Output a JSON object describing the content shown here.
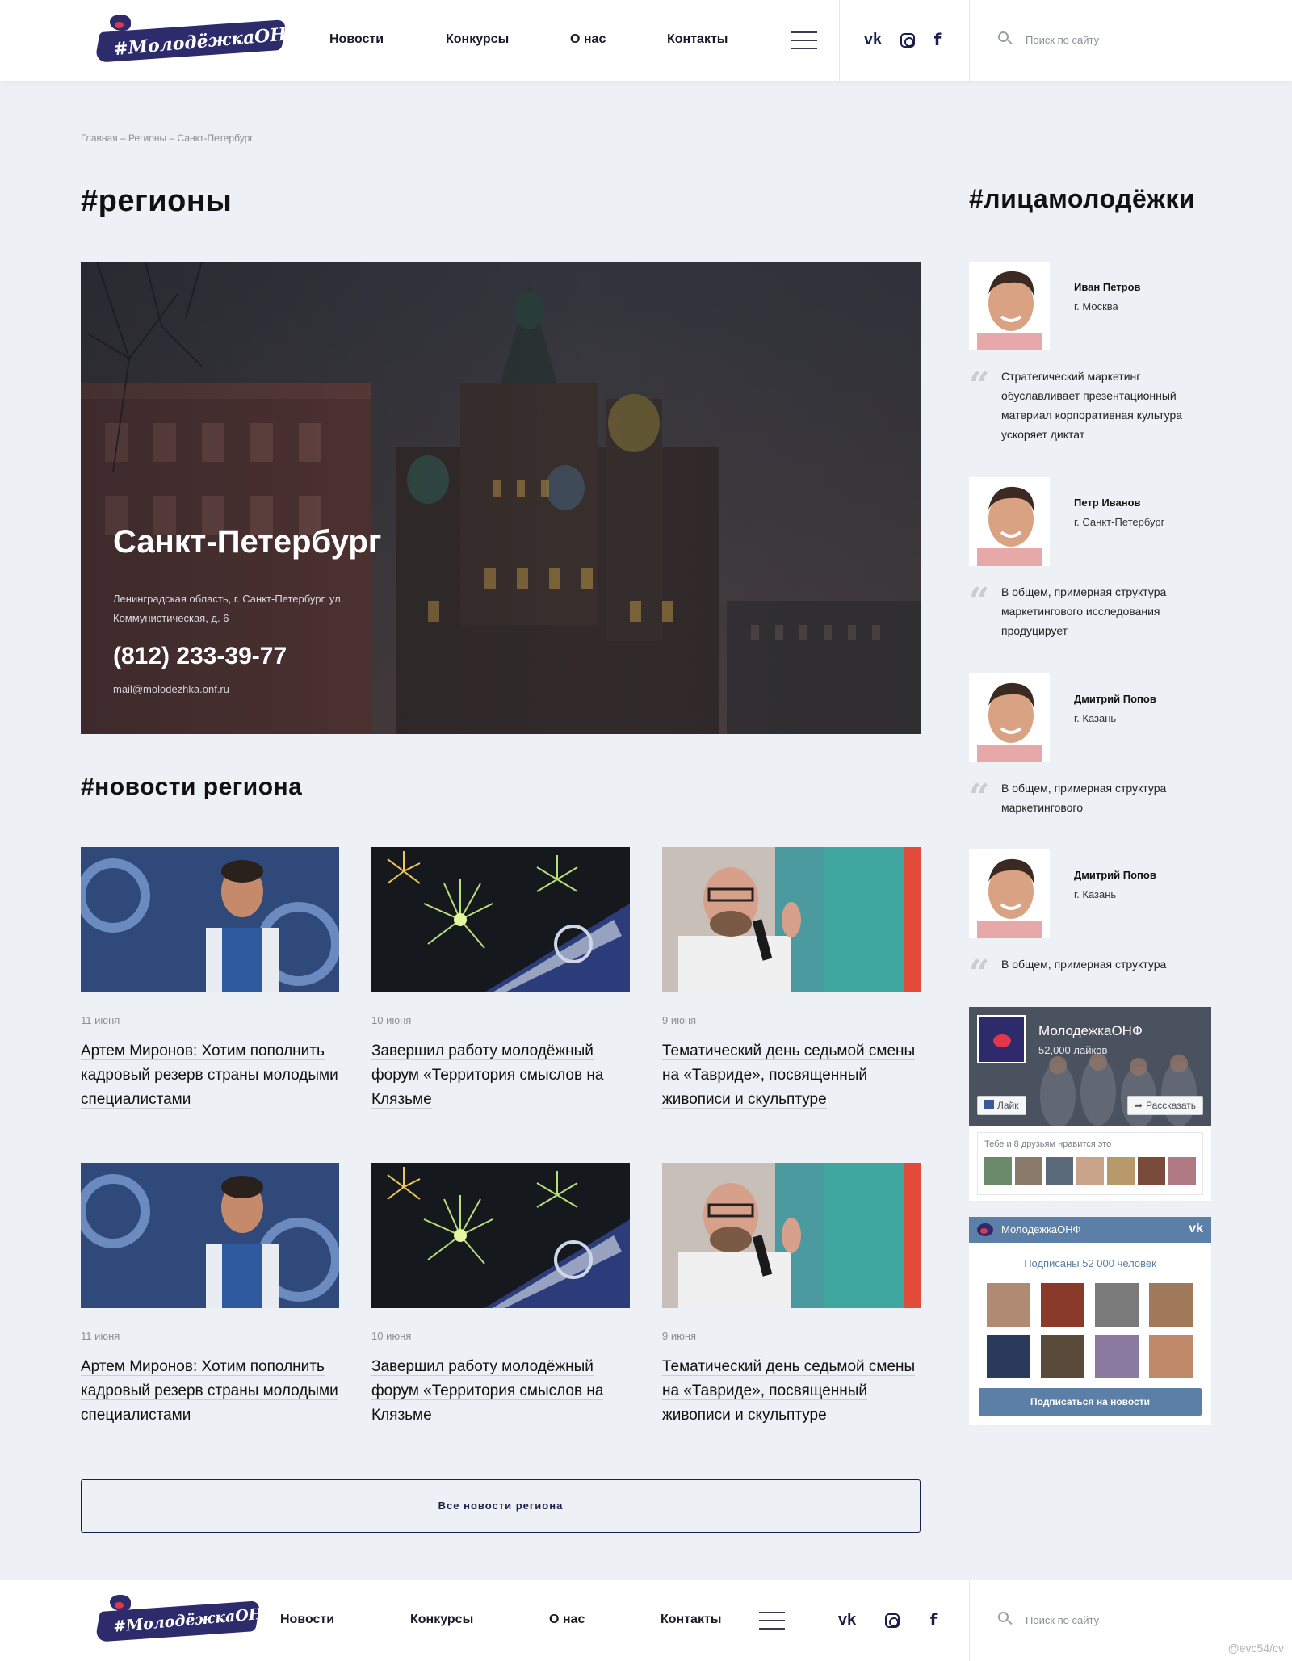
{
  "header": {
    "logo_text": "#МолодёжкаОНФ",
    "nav": [
      "Новости",
      "Конкурсы",
      "О нас",
      "Контакты"
    ],
    "search_placeholder": "Поиск по сайту"
  },
  "breadcrumb": "Главная – Регионы – Санкт-Петербург",
  "page_title": "#регионы",
  "sidebar_title": "#лицамолодёжки",
  "hero": {
    "city": "Санкт-Петербург",
    "address": "Ленинградская область, г. Санкт-Петербург, ул. Коммунистическая, д. 6",
    "phone": "(812) 233-39-77",
    "email": "mail@molodezhka.onf.ru"
  },
  "news_title": "#новости региона",
  "news": [
    {
      "date": "11 июня",
      "title": "Артем Миронов: Хотим пополнить кадровый резерв страны молодыми специалистами"
    },
    {
      "date": "10 июня",
      "title": "Завершил работу молодёжный форум «Территория смыслов на Клязьме"
    },
    {
      "date": "9 июня",
      "title": "Тематический день седьмой смены на «Тавриде», посвященный живописи и скульптуре"
    },
    {
      "date": "11 июня",
      "title": "Артем Миронов: Хотим пополнить кадровый резерв страны молодыми специалистами"
    },
    {
      "date": "10 июня",
      "title": "Завершил работу молодёжный форум «Территория смыслов на Клязьме"
    },
    {
      "date": "9 июня",
      "title": "Тематический день седьмой смены на «Тавриде», посвященный живописи и скульптуре"
    }
  ],
  "more_button": "Все новости региона",
  "people": [
    {
      "name": "Иван Петров",
      "city": "г. Москва",
      "quote": "Стратегический маркетинг обуславливает презентационный материал корпоративная культура ускоряет диктат"
    },
    {
      "name": "Петр Иванов",
      "city": "г. Санкт-Петербург",
      "quote": "В общем, примерная структура маркетингового исследования продуцирует"
    },
    {
      "name": "Дмитрий Попов",
      "city": "г. Казань",
      "quote": "В общем, примерная структура маркетингового"
    },
    {
      "name": "Дмитрий Попов",
      "city": "г. Казань",
      "quote": "В общем, примерная структура"
    }
  ],
  "fb_widget": {
    "page_name": "МолодежкаОНФ",
    "likes": "52,000 лайков",
    "like_btn": "Лайк",
    "share_btn": "Рассказать",
    "friends_text": "Тебе и 8 друзьям нравится это"
  },
  "vk_widget": {
    "page_name": "МолодежкаОНФ",
    "subscribers": "Подписаны 52 000 человек",
    "subscribe_btn": "Подписаться на новости"
  },
  "footer": {
    "logo_text": "#МолодёжкаОНФ",
    "nav": [
      "Новости",
      "Конкурсы",
      "О нас",
      "Контакты"
    ],
    "search_placeholder": "Поиск по сайту"
  },
  "watermark": "@evc54/cv",
  "colors": {
    "brand": "#2d2b6b",
    "accent": "#e2374a",
    "vk": "#5b7fa6",
    "bg": "#edf0f4"
  }
}
